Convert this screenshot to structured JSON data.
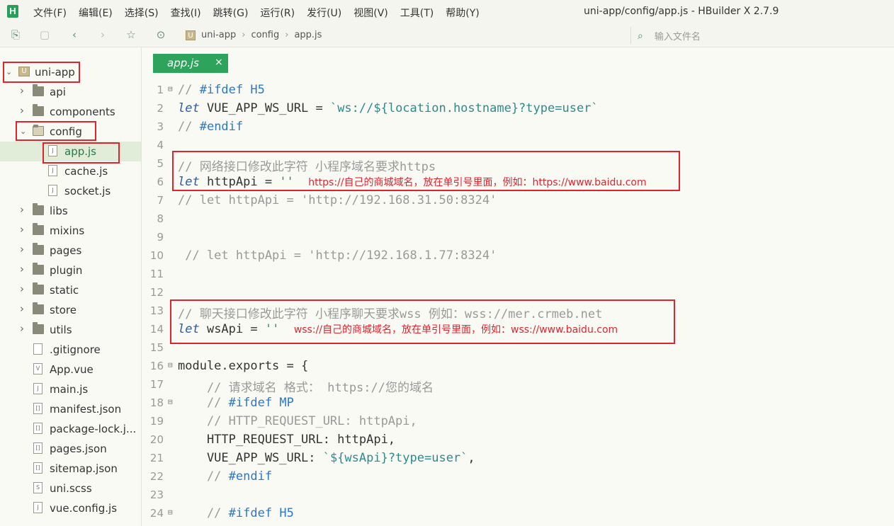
{
  "window": {
    "title": "uni-app/config/app.js - HBuilder X 2.7.9",
    "logo_letter": "H"
  },
  "menu": [
    "文件(F)",
    "编辑(E)",
    "选择(S)",
    "查找(I)",
    "跳转(G)",
    "运行(R)",
    "发行(U)",
    "视图(V)",
    "工具(T)",
    "帮助(Y)"
  ],
  "toolbar": {
    "icons": [
      "new-file-icon",
      "save-icon",
      "back-icon",
      "forward-icon",
      "star-icon",
      "run-icon"
    ],
    "breadcrumb": [
      "uni-app",
      "config",
      "app.js"
    ],
    "file_search_placeholder": "输入文件名"
  },
  "sidebar": {
    "project": "uni-app",
    "items": [
      {
        "label": "uni-app",
        "type": "project",
        "depth": 0,
        "expanded": true
      },
      {
        "label": "api",
        "type": "folder",
        "depth": 1
      },
      {
        "label": "components",
        "type": "folder",
        "depth": 1
      },
      {
        "label": "config",
        "type": "folder",
        "depth": 1,
        "expanded": true
      },
      {
        "label": "app.js",
        "type": "file",
        "depth": 2,
        "selected": true
      },
      {
        "label": "cache.js",
        "type": "file",
        "depth": 2
      },
      {
        "label": "socket.js",
        "type": "file",
        "depth": 2
      },
      {
        "label": "libs",
        "type": "folder",
        "depth": 1
      },
      {
        "label": "mixins",
        "type": "folder",
        "depth": 1
      },
      {
        "label": "pages",
        "type": "folder",
        "depth": 1
      },
      {
        "label": "plugin",
        "type": "folder",
        "depth": 1
      },
      {
        "label": "static",
        "type": "folder",
        "depth": 1
      },
      {
        "label": "store",
        "type": "folder",
        "depth": 1
      },
      {
        "label": "utils",
        "type": "folder",
        "depth": 1
      },
      {
        "label": ".gitignore",
        "type": "file",
        "depth": 1
      },
      {
        "label": "App.vue",
        "type": "vue",
        "depth": 1
      },
      {
        "label": "main.js",
        "type": "file",
        "depth": 1
      },
      {
        "label": "manifest.json",
        "type": "json",
        "depth": 1
      },
      {
        "label": "package-lock.j...",
        "type": "json",
        "depth": 1
      },
      {
        "label": "pages.json",
        "type": "json",
        "depth": 1
      },
      {
        "label": "sitemap.json",
        "type": "json",
        "depth": 1
      },
      {
        "label": "uni.scss",
        "type": "scss",
        "depth": 1
      },
      {
        "label": "vue.config.js",
        "type": "file",
        "depth": 1
      }
    ]
  },
  "editor": {
    "tab_label": "app.js",
    "tab_close": "×",
    "lines": [
      {
        "n": "1",
        "fold": true,
        "parts": [
          [
            "c-com",
            "// "
          ],
          [
            "c-bl",
            "#ifdef"
          ],
          [
            "c-com",
            " "
          ],
          [
            "c-bl",
            "H5"
          ]
        ]
      },
      {
        "n": "2",
        "parts": [
          [
            "c-kw",
            "let"
          ],
          [
            "c-id",
            " VUE_APP_WS_URL = "
          ],
          [
            "c-str",
            "`ws://${location.hostname}?type=user`"
          ]
        ]
      },
      {
        "n": "3",
        "parts": [
          [
            "c-com",
            "// "
          ],
          [
            "c-bl",
            "#endif"
          ]
        ]
      },
      {
        "n": "4",
        "parts": []
      },
      {
        "n": "5",
        "parts": [
          [
            "c-com",
            "// 网络接口修改此字符 小程序域名要求https"
          ]
        ]
      },
      {
        "n": "6",
        "parts": [
          [
            "c-kw",
            "let"
          ],
          [
            "c-id",
            " httpApi = "
          ],
          [
            "c-str",
            "''"
          ],
          [
            "c-id",
            "  "
          ],
          [
            "c-ann",
            "https://自己的商城域名，放在单引号里面，例如：https://www.baidu.com"
          ]
        ]
      },
      {
        "n": "7",
        "parts": [
          [
            "c-com",
            "// let httpApi = 'http://192.168.31.50:8324'"
          ]
        ]
      },
      {
        "n": "8",
        "parts": []
      },
      {
        "n": "9",
        "parts": []
      },
      {
        "n": "10",
        "parts": [
          [
            "c-com",
            " // let httpApi = 'http://192.168.1.77:8324'"
          ]
        ]
      },
      {
        "n": "11",
        "parts": []
      },
      {
        "n": "12",
        "parts": []
      },
      {
        "n": "13",
        "parts": [
          [
            "c-com",
            "// 聊天接口修改此字符 小程序聊天要求wss 例如：wss://mer.crmeb.net"
          ]
        ]
      },
      {
        "n": "14",
        "parts": [
          [
            "c-kw",
            "let"
          ],
          [
            "c-id",
            " wsApi = "
          ],
          [
            "c-str",
            "''"
          ],
          [
            "c-id",
            "  "
          ],
          [
            "c-ann",
            "wss://自己的商城域名，放在单引号里面，例如：wss://www.baidu.com"
          ]
        ]
      },
      {
        "n": "15",
        "parts": []
      },
      {
        "n": "16",
        "fold": true,
        "parts": [
          [
            "c-id",
            "module.exports = {"
          ]
        ]
      },
      {
        "n": "17",
        "parts": [
          [
            "c-com",
            "    // 请求域名 格式： https://您的域名"
          ]
        ]
      },
      {
        "n": "18",
        "fold": true,
        "parts": [
          [
            "c-com",
            "    // "
          ],
          [
            "c-bl",
            "#ifdef"
          ],
          [
            "c-com",
            " "
          ],
          [
            "c-bl",
            "MP"
          ]
        ]
      },
      {
        "n": "19",
        "parts": [
          [
            "c-com",
            "    // HTTP_REQUEST_URL: httpApi,"
          ]
        ]
      },
      {
        "n": "20",
        "parts": [
          [
            "c-id",
            "    HTTP_REQUEST_URL: httpApi,"
          ]
        ]
      },
      {
        "n": "21",
        "parts": [
          [
            "c-id",
            "    VUE_APP_WS_URL: "
          ],
          [
            "c-str",
            "`${wsApi}?type=user`"
          ],
          [
            "c-id",
            ","
          ]
        ]
      },
      {
        "n": "22",
        "parts": [
          [
            "c-com",
            "    // "
          ],
          [
            "c-bl",
            "#endif"
          ]
        ]
      },
      {
        "n": "23",
        "parts": []
      },
      {
        "n": "24",
        "fold": true,
        "parts": [
          [
            "c-com",
            "    // "
          ],
          [
            "c-bl",
            "#ifdef"
          ],
          [
            "c-com",
            " "
          ],
          [
            "c-bl",
            "H5"
          ]
        ]
      }
    ]
  },
  "colors": {
    "accent": "#2ea35c",
    "annotation": "#e0242f"
  }
}
